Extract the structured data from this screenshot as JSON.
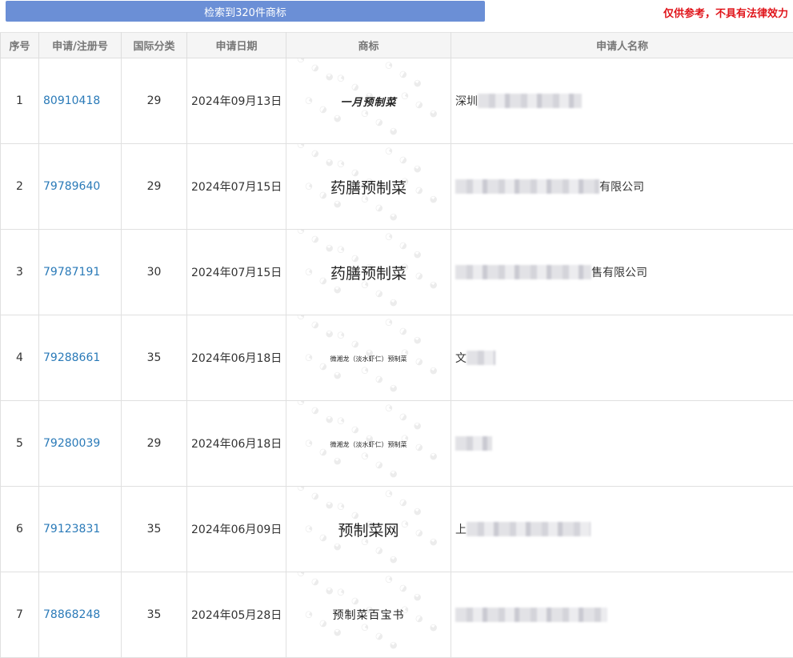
{
  "header": {
    "search_button": "检索到320件商标",
    "disclaimer": "仅供参考，不具有法律效力"
  },
  "table": {
    "columns": [
      "序号",
      "申请/注册号",
      "国际分类",
      "申请日期",
      "商标",
      "申请人名称"
    ],
    "rows": [
      {
        "seq": "1",
        "reg_no": "80910418",
        "class": "29",
        "date": "2024年09月13日",
        "mark": "一月预制菜",
        "mark_style": "brush",
        "applicant_prefix": "深圳",
        "applicant_suffix": "",
        "blur_width": 130
      },
      {
        "seq": "2",
        "reg_no": "79789640",
        "class": "29",
        "date": "2024年07月15日",
        "mark": "药膳预制菜",
        "mark_style": "large",
        "applicant_prefix": "",
        "applicant_suffix": "有限公司",
        "blur_width": 180
      },
      {
        "seq": "3",
        "reg_no": "79787191",
        "class": "30",
        "date": "2024年07月15日",
        "mark": "药膳预制菜",
        "mark_style": "large",
        "applicant_prefix": "",
        "applicant_suffix": "售有限公司",
        "blur_width": 170
      },
      {
        "seq": "4",
        "reg_no": "79288661",
        "class": "35",
        "date": "2024年06月18日",
        "mark": "微湘龙（淡水虾仁）预制菜",
        "mark_style": "small",
        "applicant_prefix": "文",
        "applicant_suffix": "",
        "blur_width": 36
      },
      {
        "seq": "5",
        "reg_no": "79280039",
        "class": "29",
        "date": "2024年06月18日",
        "mark": "微湘龙（淡水虾仁）预制菜",
        "mark_style": "small",
        "applicant_prefix": "",
        "applicant_suffix": "",
        "blur_width": 46
      },
      {
        "seq": "6",
        "reg_no": "79123831",
        "class": "35",
        "date": "2024年06月09日",
        "mark": "预制菜网",
        "mark_style": "large",
        "applicant_prefix": "上",
        "applicant_suffix": "",
        "blur_width": 155
      },
      {
        "seq": "7",
        "reg_no": "78868248",
        "class": "35",
        "date": "2024年05月28日",
        "mark": "预制菜百宝书",
        "mark_style": "serif",
        "applicant_prefix": "",
        "applicant_suffix": "",
        "blur_width": 190
      }
    ]
  }
}
